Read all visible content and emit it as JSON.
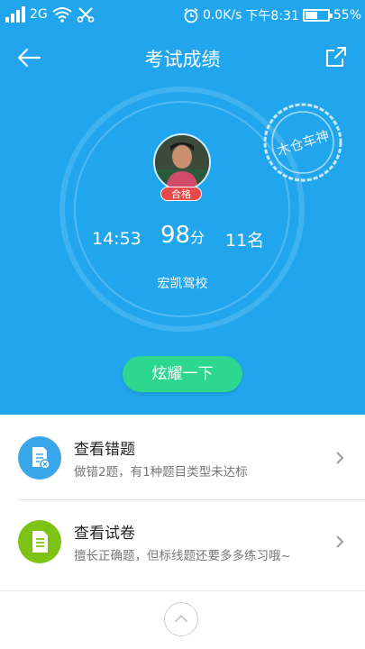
{
  "status_bar": {
    "network": "2G",
    "speed": "0.0K/s",
    "time": "下午8:31",
    "battery_percent": "55%",
    "battery_level": 0.55
  },
  "header": {
    "title": "考试成绩",
    "back_icon": "arrow-left-icon",
    "share_icon": "share-external-icon"
  },
  "stamp": {
    "text": "木仓车神"
  },
  "result": {
    "badge": "合格",
    "time_used": "14:53",
    "score": "98",
    "score_unit": "分",
    "rank": "11名",
    "school": "宏凯驾校"
  },
  "cta": {
    "label": "炫耀一下"
  },
  "list": [
    {
      "title": "查看错题",
      "subtitle": "做错2题，有1种题目类型未达标",
      "icon": "wrong-doc-icon",
      "color": "#3aa6ea"
    },
    {
      "title": "查看试卷",
      "subtitle": "擅长正确题，但标线题还要多多练习哦~",
      "icon": "paper-doc-icon",
      "color": "#7dc316"
    }
  ],
  "colors": {
    "hero": "#21a6ee",
    "cta": "#2dd78f",
    "badge": "#e84a4a"
  }
}
